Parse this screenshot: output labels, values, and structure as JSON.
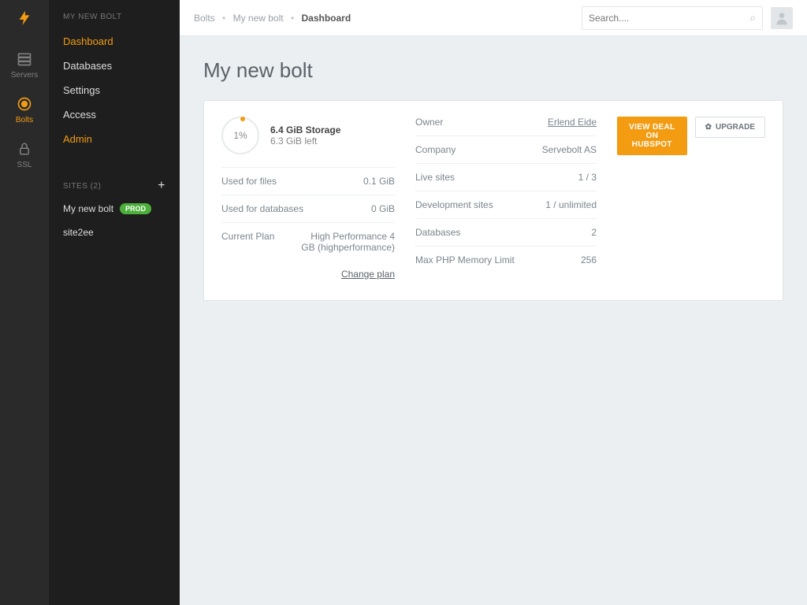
{
  "iconbar": {
    "items": [
      {
        "label": "Servers"
      },
      {
        "label": "Bolts"
      },
      {
        "label": "SSL"
      }
    ]
  },
  "subnav": {
    "title": "MY NEW BOLT",
    "items": [
      {
        "label": "Dashboard"
      },
      {
        "label": "Databases"
      },
      {
        "label": "Settings"
      },
      {
        "label": "Access"
      },
      {
        "label": "Admin"
      }
    ],
    "sites_header": "SITES (2)",
    "sites": [
      {
        "label": "My new bolt",
        "badge": "PROD"
      },
      {
        "label": "site2ee",
        "badge": ""
      }
    ]
  },
  "breadcrumb": {
    "a": "Bolts",
    "b": "My new bolt",
    "c": "Dashboard"
  },
  "search": {
    "placeholder": "Search...."
  },
  "page": {
    "title": "My new bolt"
  },
  "storage": {
    "percent": "1%",
    "line1": "6.4 GiB Storage",
    "line2": "6.3 GiB left"
  },
  "left_kv": [
    {
      "k": "Used for files",
      "v": "0.1 GiB"
    },
    {
      "k": "Used for databases",
      "v": "0 GiB"
    },
    {
      "k": "Current Plan",
      "v": "High Performance 4 GB (highperformance)"
    }
  ],
  "change_plan": "Change plan",
  "mid_kv": [
    {
      "k": "Owner",
      "v": "Erlend Eide",
      "link": true
    },
    {
      "k": "Company",
      "v": "Servebolt AS"
    },
    {
      "k": "Live sites",
      "v": "1 / 3"
    },
    {
      "k": "Development sites",
      "v": "1 / unlimited"
    },
    {
      "k": "Databases",
      "v": "2"
    },
    {
      "k": "Max PHP Memory Limit",
      "v": "256"
    }
  ],
  "buttons": {
    "view_deal": "VIEW DEAL ON HUBSPOT",
    "upgrade": "UPGRADE"
  }
}
